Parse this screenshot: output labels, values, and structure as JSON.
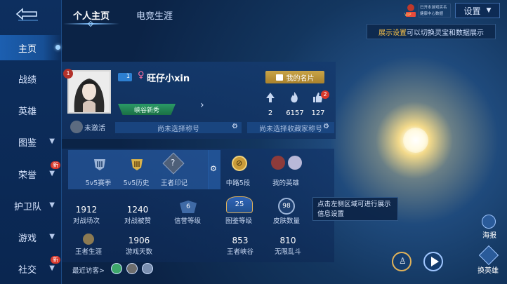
{
  "sidebar": {
    "items": [
      {
        "label": "主页",
        "active": true
      },
      {
        "label": "战绩"
      },
      {
        "label": "英雄"
      },
      {
        "label": "图鉴"
      },
      {
        "label": "荣誉",
        "badge": "新"
      },
      {
        "label": "护卫队"
      },
      {
        "label": "游戏"
      },
      {
        "label": "社交",
        "badge": "新"
      }
    ]
  },
  "tabs": [
    {
      "label": "个人主页"
    },
    {
      "label": "电竞生涯"
    }
  ],
  "topbar": {
    "vip_label": "VIP",
    "vip_line1": "已开本游戏实名",
    "vip_line2": "健康中心数据",
    "settings_label": "设置",
    "tip_highlight": "展示设置",
    "tip_rest": "可以切换灵宝和数据展示"
  },
  "profile": {
    "avatar_badge": "1",
    "level": "1",
    "gender_symbol": "♀",
    "name": "旺仔小xin",
    "rank_tag": "峡谷新秀",
    "card_button": "我的名片",
    "stats": [
      {
        "value": "2"
      },
      {
        "value": "6157"
      },
      {
        "value": "127",
        "badge": "2"
      }
    ],
    "inactive_label": "未激活",
    "title_slot_1": "尚未选择称号",
    "title_slot_2": "尚未选择收藏家称号"
  },
  "grid": {
    "row1": [
      {
        "label": "5v5赛季"
      },
      {
        "label": "5v5历史"
      },
      {
        "label": "王者印记"
      },
      {
        "label": "中路5段"
      },
      {
        "label": "我的英雄"
      }
    ],
    "row2": [
      {
        "value": "1912",
        "label": "对战场次"
      },
      {
        "value": "1240",
        "label": "对战被赞"
      },
      {
        "value": "6",
        "label": "信誉等级"
      },
      {
        "value": "25",
        "label": "图鉴等级"
      },
      {
        "value": "98",
        "label": "皮肤数量"
      }
    ],
    "row3": [
      {
        "value": "",
        "label": "王者生涯"
      },
      {
        "value": "1906",
        "label": "游戏天数"
      },
      {
        "value": "853",
        "label": "王者峡谷"
      },
      {
        "value": "810",
        "label": "无限乱斗"
      }
    ],
    "visitors_label": "最近访客>"
  },
  "hint": "点击左侧区域可进行展示信息设置",
  "right": {
    "poster": "海报",
    "switch_hero": "换英雄"
  },
  "colors": {
    "accent_gold": "#c9a448",
    "highlight": "#f5c04a",
    "badge_red": "#d8382b"
  }
}
